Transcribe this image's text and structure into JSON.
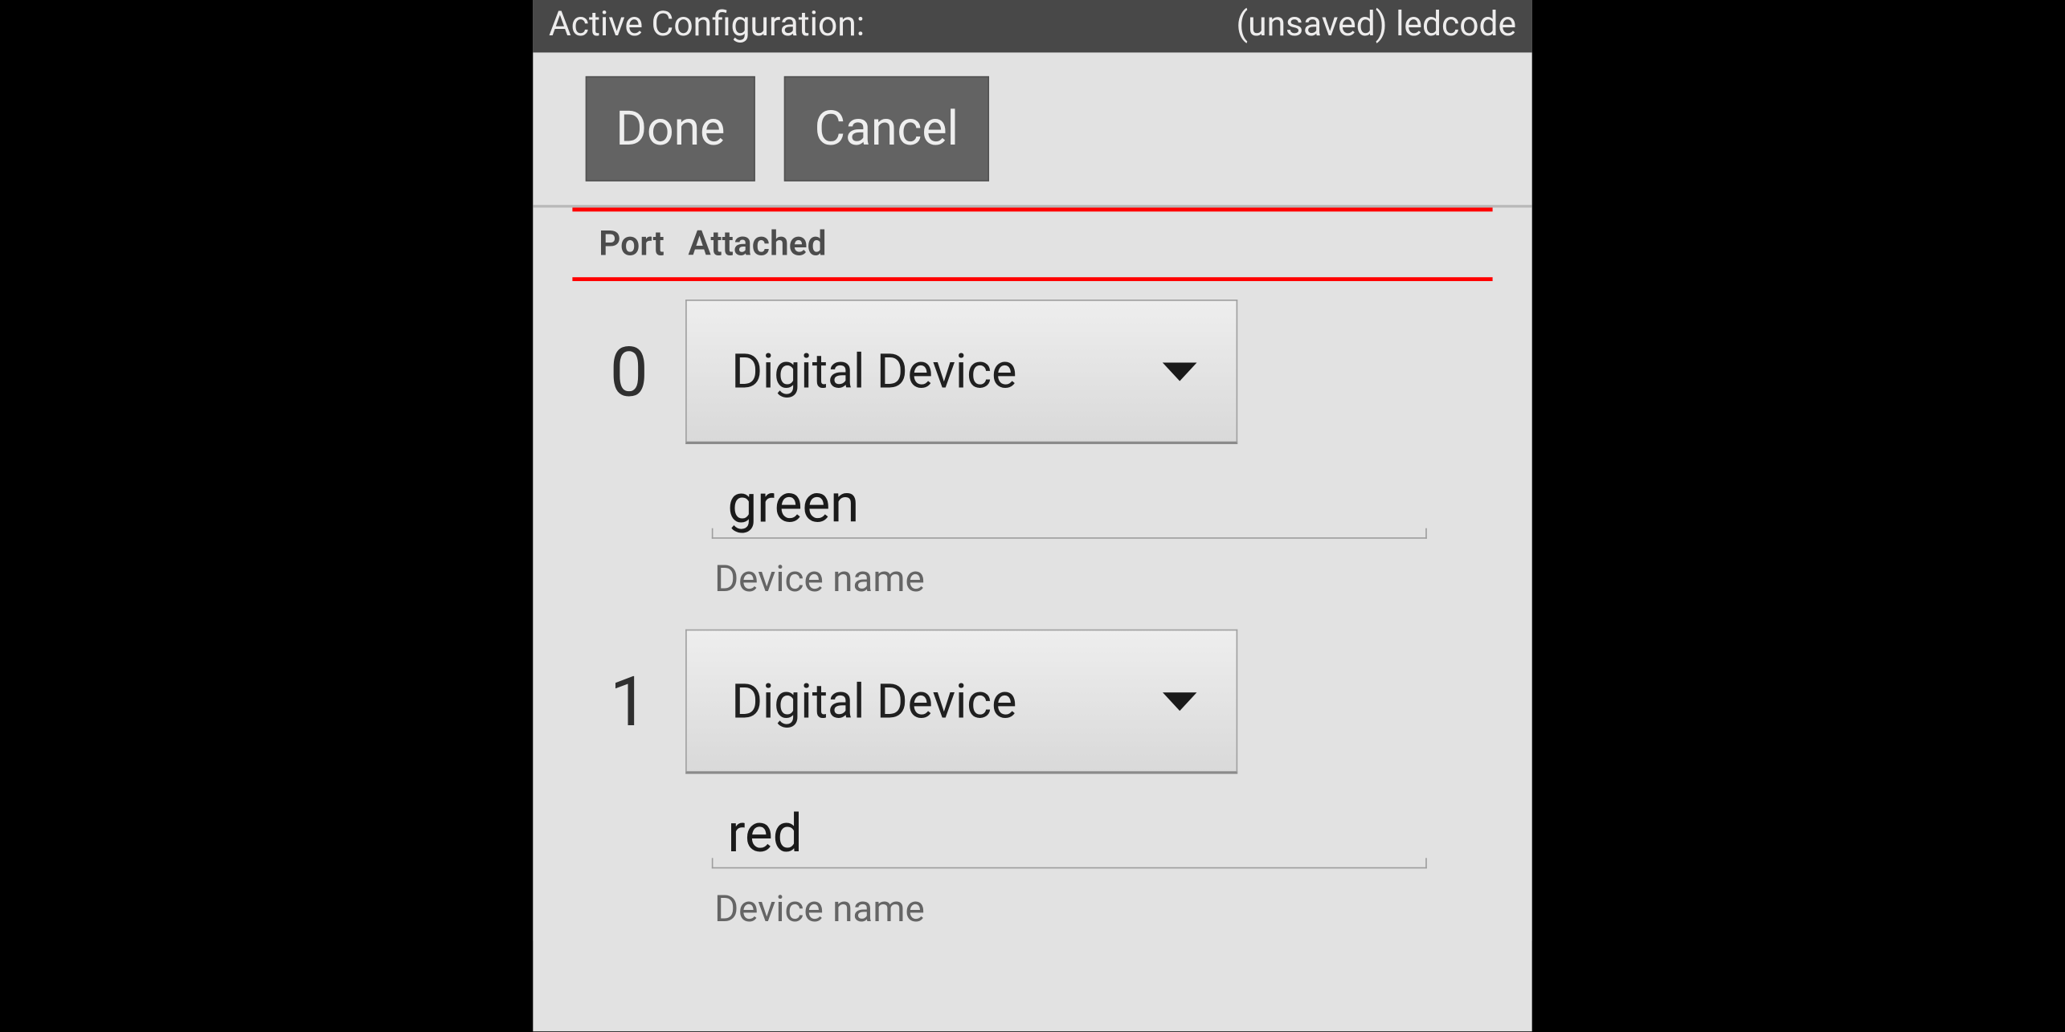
{
  "header": {
    "title_label": "Active Configuration:",
    "config_name": "(unsaved) ledcode"
  },
  "buttons": {
    "done": "Done",
    "cancel": "Cancel"
  },
  "table": {
    "col_port": "Port",
    "col_attached": "Attached"
  },
  "ports": [
    {
      "number": "0",
      "device_type": "Digital Device",
      "device_name": "green",
      "name_label": "Device name"
    },
    {
      "number": "1",
      "device_type": "Digital Device",
      "device_name": "red",
      "name_label": "Device name"
    }
  ]
}
